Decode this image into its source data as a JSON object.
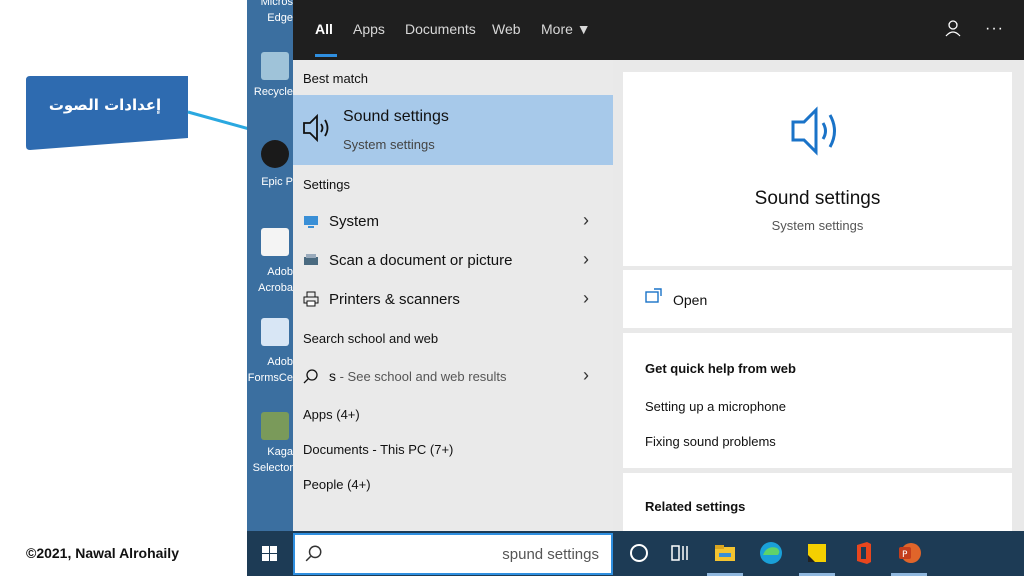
{
  "annotation": {
    "callout_text": "إعدادات الصوت",
    "copyright": "©2021, Nawal Alrohaily",
    "callout_color": "#2e6bb0"
  },
  "desktop": {
    "items": [
      {
        "label": "Micros"
      },
      {
        "label": "Edge"
      },
      {
        "label": "Recycle"
      },
      {
        "label": "Epic P"
      },
      {
        "label": "Adob"
      },
      {
        "label": "Acroba"
      },
      {
        "label": "Adob"
      },
      {
        "label": "FormsCe"
      },
      {
        "label": "Kaga"
      },
      {
        "label": "Selector"
      }
    ]
  },
  "search_panel": {
    "tabs": [
      {
        "label": "All",
        "active": true
      },
      {
        "label": "Apps"
      },
      {
        "label": "Documents"
      },
      {
        "label": "Web"
      },
      {
        "label": "More ▼"
      }
    ],
    "more_dots": "···",
    "best_match_heading": "Best match",
    "best_match": {
      "title": "Sound settings",
      "subtitle": "System settings",
      "icon": "speaker-icon"
    },
    "settings_heading": "Settings",
    "settings_items": [
      {
        "label": "System",
        "icon": "display-icon"
      },
      {
        "label": "Scan a document or picture",
        "icon": "scanner-icon"
      },
      {
        "label": "Printers & scanners",
        "icon": "printer-icon"
      }
    ],
    "web_heading": "Search school and web",
    "web_item": {
      "query": "s",
      "suffix": " - See school and web results"
    },
    "categories": [
      "Apps (4+)",
      "Documents - This PC (7+)",
      "People (4+)"
    ],
    "preview": {
      "title": "Sound settings",
      "subtitle": "System settings",
      "open_label": "Open",
      "help_heading": "Get quick help from web",
      "help_links": [
        "Setting up a microphone",
        "Fixing sound problems"
      ],
      "related_heading": "Related settings"
    }
  },
  "taskbar": {
    "search_value": "spund settings",
    "accent": "#2f8fe0",
    "icons": [
      "start-icon",
      "cortana-icon",
      "task-view-icon",
      "file-explorer-icon",
      "edge-icon",
      "sticky-notes-icon",
      "office-icon",
      "powerpoint-icon"
    ]
  }
}
